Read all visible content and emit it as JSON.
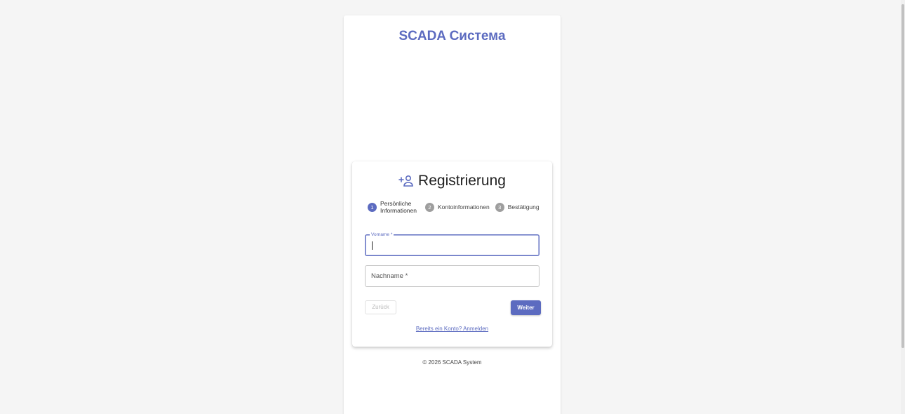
{
  "app": {
    "brand_title": "SCADA Система",
    "accent_color": "#5c6bc0"
  },
  "card": {
    "icon": "person-add-icon",
    "title": "Registrierung"
  },
  "stepper": {
    "steps": [
      {
        "number": "1",
        "label": "Persönliche Informationen",
        "state": "active"
      },
      {
        "number": "2",
        "label": "Kontoinformationen",
        "state": "inactive"
      },
      {
        "number": "3",
        "label": "Bestätigung",
        "state": "inactive"
      }
    ]
  },
  "form": {
    "first_name": {
      "label": "Vorname *",
      "value": ""
    },
    "last_name": {
      "label": "Nachname *",
      "value": ""
    }
  },
  "actions": {
    "back_label": "Zurück",
    "next_label": "Weiter",
    "login_link": "Bereits ein Konto? Anmelden"
  },
  "footer": {
    "copyright": "© 2026 SCADA System"
  }
}
